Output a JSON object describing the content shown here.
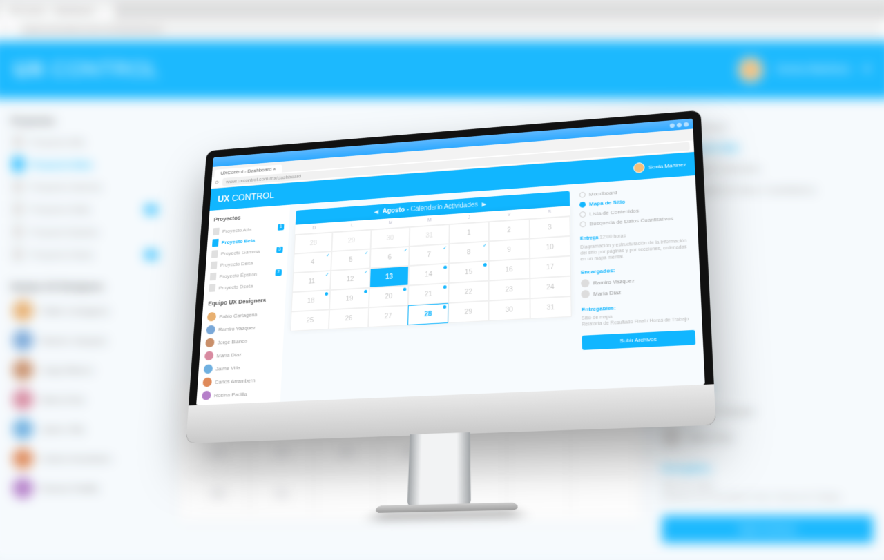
{
  "browser": {
    "tab_title": "UXControl - Dashboard",
    "url": "www.uxcontrol.com.mx/dashboard"
  },
  "app": {
    "logo_bold": "UX",
    "logo_light": "CONTROL",
    "user_name": "Sonia Martinez"
  },
  "sidebar": {
    "projects_title": "Proyectos",
    "projects": [
      {
        "label": "Proyecto Alfa",
        "badge": "1"
      },
      {
        "label": "Proyecto Beta",
        "badge": ""
      },
      {
        "label": "Proyecto Gamma",
        "badge": "3"
      },
      {
        "label": "Proyecto Delta",
        "badge": ""
      },
      {
        "label": "Proyecto Épsilon",
        "badge": "2"
      },
      {
        "label": "Proyecto Dseta",
        "badge": ""
      }
    ],
    "team_title": "Equipo UX Designers",
    "team": [
      {
        "name": "Pablo Cartagena"
      },
      {
        "name": "Ramiro Vazquez"
      },
      {
        "name": "Jorge Blanco"
      },
      {
        "name": "María Díaz"
      },
      {
        "name": "Jaime Villa"
      },
      {
        "name": "Carlos Arrambern"
      },
      {
        "name": "Rosina Padilla"
      }
    ]
  },
  "calendar": {
    "month": "Agosto",
    "subtitle": "Calendario Actividades",
    "dow": [
      "D",
      "L",
      "M",
      "M",
      "J",
      "V",
      "S"
    ],
    "weeks": [
      [
        {
          "n": "28",
          "dim": true
        },
        {
          "n": "29",
          "dim": true
        },
        {
          "n": "30",
          "dim": true
        },
        {
          "n": "31",
          "dim": true
        },
        {
          "n": "1"
        },
        {
          "n": "2"
        },
        {
          "n": "3"
        }
      ],
      [
        {
          "n": "4",
          "ck": true
        },
        {
          "n": "5",
          "ck": true
        },
        {
          "n": "6",
          "ck": true
        },
        {
          "n": "7",
          "ck": true
        },
        {
          "n": "8",
          "ck": true
        },
        {
          "n": "9"
        },
        {
          "n": "10"
        }
      ],
      [
        {
          "n": "11",
          "ck": true
        },
        {
          "n": "12",
          "ck": true
        },
        {
          "n": "13",
          "today": true
        },
        {
          "n": "14",
          "cd": true
        },
        {
          "n": "15",
          "cd": true
        },
        {
          "n": "16"
        },
        {
          "n": "17"
        }
      ],
      [
        {
          "n": "18",
          "cd": true
        },
        {
          "n": "19",
          "cd": true
        },
        {
          "n": "20",
          "cd": true
        },
        {
          "n": "21",
          "cd": true
        },
        {
          "n": "22"
        },
        {
          "n": "23"
        },
        {
          "n": "24"
        }
      ],
      [
        {
          "n": "25"
        },
        {
          "n": "26"
        },
        {
          "n": "27"
        },
        {
          "n": "28",
          "boxed": true,
          "cd": true
        },
        {
          "n": "29"
        },
        {
          "n": "30"
        },
        {
          "n": "31"
        }
      ]
    ]
  },
  "detail": {
    "nav": [
      {
        "label": "Moodboard"
      },
      {
        "label": "Mapa de Sitio",
        "active": true
      },
      {
        "label": "Lista de Contenidos"
      },
      {
        "label": "Búsqueda de Datos Cuantitativos"
      }
    ],
    "deadline_label": "Entrega",
    "deadline_value": "12:00 horas",
    "desc": "Diagramación y estructuración de la información del sitio por páginas y por secciones, ordenadas en un mapa mental.",
    "assignees_title": "Encargados:",
    "assignees": [
      {
        "name": "Ramiro Vazquez"
      },
      {
        "name": "María Díaz"
      }
    ],
    "deliverables_title": "Entregables:",
    "deliverables": [
      "Sitio de mapa",
      "Relatoría de Resultado Final / Horas de Trabajo"
    ],
    "upload_btn": "Subir Archivos"
  },
  "bg_calendar_visible": {
    "row1": [
      "",
      "",
      "",
      "",
      "",
      "",
      "22"
    ],
    "row2": [
      "23",
      "24",
      "25",
      "26",
      "",
      "",
      ""
    ],
    "row3": [
      "30",
      "31",
      "",
      "",
      "",
      "",
      ""
    ]
  }
}
